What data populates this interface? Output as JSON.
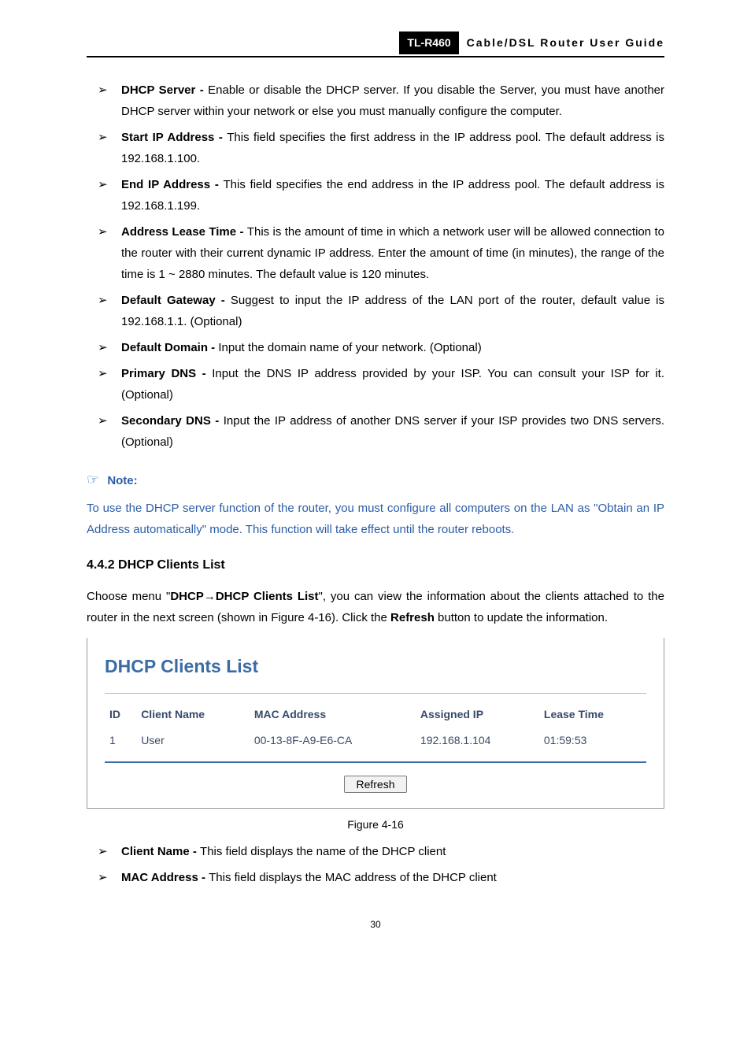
{
  "header": {
    "model": "TL-R460",
    "guide": "Cable/DSL  Router  User  Guide"
  },
  "bullets1": [
    {
      "term": "DHCP Server - ",
      "desc": "Enable or disable the DHCP server. If you disable the Server, you must have another DHCP server within your network or else you must manually configure the computer."
    },
    {
      "term": "Start IP Address - ",
      "desc": "This field specifies the first address in the IP address pool. The default address is 192.168.1.100."
    },
    {
      "term": "End IP Address - ",
      "desc": "This field specifies the end address in the IP address pool. The default address is 192.168.1.199."
    },
    {
      "term": "Address Lease Time - ",
      "desc": "This is the amount of time in which a network user will be allowed connection to the router with their current dynamic IP address. Enter the amount of time (in minutes), the range of the time is 1 ~ 2880 minutes. The default value is 120 minutes."
    },
    {
      "term": "Default Gateway - ",
      "desc": "Suggest to input the IP address of the LAN port of the router, default value is 192.168.1.1. (Optional)"
    },
    {
      "term": "Default Domain - ",
      "desc": "Input the domain name of your network. (Optional)"
    },
    {
      "term": "Primary DNS - ",
      "desc": "Input the DNS IP address provided by your ISP. You can consult your ISP for it. (Optional)"
    },
    {
      "term": "Secondary DNS - ",
      "desc": "Input the IP address of another DNS server if your ISP provides two DNS servers. (Optional)"
    }
  ],
  "note": {
    "label": "Note:",
    "body": "To use the DHCP server function of the router, you must configure all computers on the LAN as \"Obtain an IP Address automatically\" mode. This function will take effect until the router reboots."
  },
  "section": {
    "heading": "4.4.2  DHCP Clients List",
    "para_pre": "Choose menu \"",
    "para_bold": "DHCP→DHCP Clients List",
    "para_mid": "\", you can view the information about the clients attached to the router in the next screen (shown in Figure 4-16). Click the ",
    "para_bold2": "Refresh",
    "para_post": " button to update the information."
  },
  "figure": {
    "title": "DHCP Clients List",
    "headers": {
      "id": "ID",
      "name": "Client Name",
      "mac": "MAC Address",
      "ip": "Assigned IP",
      "lease": "Lease Time"
    },
    "rows": [
      {
        "id": "1",
        "name": "User",
        "mac": "00-13-8F-A9-E6-CA",
        "ip": "192.168.1.104",
        "lease": "01:59:53"
      }
    ],
    "refresh": "Refresh",
    "caption": "Figure 4-16"
  },
  "bullets2": [
    {
      "term": "Client Name - ",
      "desc": "This field displays the name of the DHCP client"
    },
    {
      "term": "MAC Address - ",
      "desc": "This field displays the MAC address of the DHCP client"
    }
  ],
  "pagenum": "30"
}
